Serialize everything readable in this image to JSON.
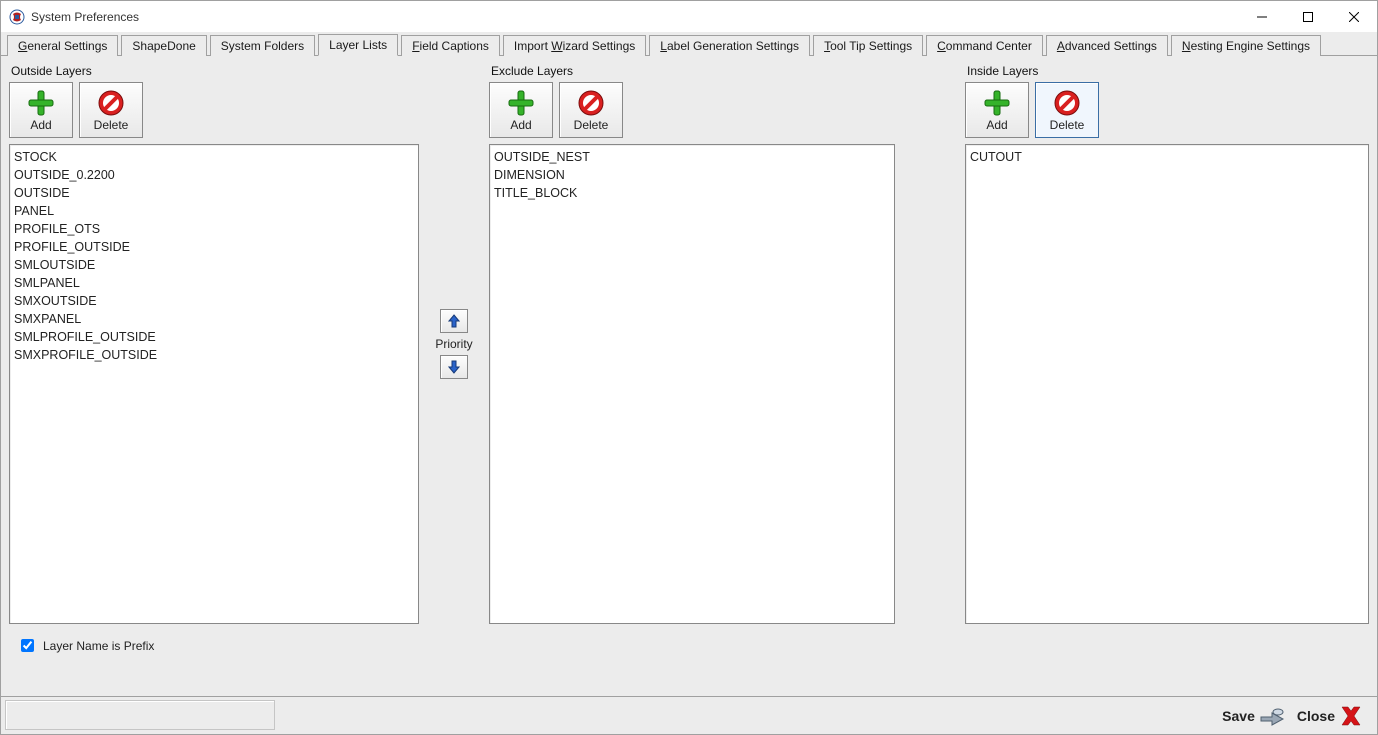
{
  "window": {
    "title": "System Preferences"
  },
  "tabs": [
    {
      "label": "General Settings",
      "ul": "G"
    },
    {
      "label": "ShapeDone",
      "ul": ""
    },
    {
      "label": "System Folders",
      "ul": ""
    },
    {
      "label": "Layer Lists",
      "ul": "",
      "active": true
    },
    {
      "label": "Field Captions",
      "ul": "F"
    },
    {
      "label": "Import Wizard Settings",
      "ul": "W"
    },
    {
      "label": "Label Generation Settings",
      "ul": "L"
    },
    {
      "label": "Tool Tip Settings",
      "ul": "T"
    },
    {
      "label": "Command Center",
      "ul": "C"
    },
    {
      "label": "Advanced Settings",
      "ul": "A"
    },
    {
      "label": "Nesting Engine Settings",
      "ul": "N"
    }
  ],
  "sections": {
    "outside": {
      "title": "Outside Layers",
      "add": "Add",
      "delete": "Delete",
      "items": [
        "STOCK",
        "OUTSIDE_0.2200",
        "OUTSIDE",
        "PANEL",
        "PROFILE_OTS",
        "PROFILE_OUTSIDE",
        "SMLOUTSIDE",
        "SMLPANEL",
        "SMXOUTSIDE",
        "SMXPANEL",
        "SMLPROFILE_OUTSIDE",
        "SMXPROFILE_OUTSIDE"
      ]
    },
    "exclude": {
      "title": "Exclude Layers",
      "add": "Add",
      "delete": "Delete",
      "items": [
        "OUTSIDE_NEST",
        "DIMENSION",
        "TITLE_BLOCK"
      ]
    },
    "inside": {
      "title": "Inside Layers",
      "add": "Add",
      "delete": "Delete",
      "items": [
        "CUTOUT"
      ]
    }
  },
  "priority": {
    "label": "Priority"
  },
  "checkbox": {
    "label": "Layer Name is Prefix",
    "checked": true
  },
  "footer": {
    "save": "Save",
    "close": "Close"
  }
}
